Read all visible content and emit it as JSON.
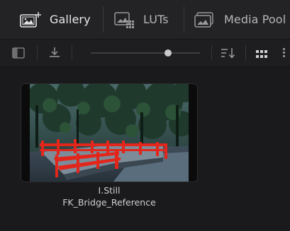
{
  "tabs": [
    {
      "label": "Gallery",
      "icon": "gallery-icon",
      "active": true
    },
    {
      "label": "LUTs",
      "icon": "luts-icon",
      "active": false
    },
    {
      "label": "Media Pool",
      "icon": "media-pool-icon",
      "active": false
    }
  ],
  "toolbar": {
    "icons": [
      "sidebar-toggle-icon",
      "import-icon",
      "zoom-slider",
      "sort-icon",
      "grid-view-icon",
      "list-view-icon"
    ],
    "zoom_level": 0.72
  },
  "stills": [
    {
      "index_label": "I.Still",
      "name": "FK_Bridge_Reference",
      "selected": false
    }
  ],
  "colors": {
    "accent_bridge": "#e2261b",
    "panel_bg": "#1a1a1c",
    "tab_bg": "#232326"
  }
}
